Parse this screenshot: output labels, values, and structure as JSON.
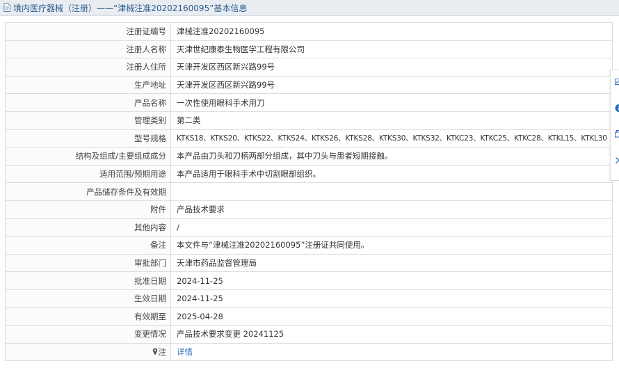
{
  "header": {
    "title": "境内医疗器械（注册）——“津械注准20202160095”基本信息"
  },
  "rows": [
    {
      "label": "注册证编号",
      "value": "津械注准20202160095"
    },
    {
      "label": "注册人名称",
      "value": "天津世纪康泰生物医学工程有限公司"
    },
    {
      "label": "注册人住所",
      "value": "天津开发区西区新兴路99号"
    },
    {
      "label": "生产地址",
      "value": "天津开发区西区新兴路99号"
    },
    {
      "label": "产品名称",
      "value": "一次性使用眼科手术用刀"
    },
    {
      "label": "管理类别",
      "value": "第二类"
    },
    {
      "label": "型号规格",
      "value": "KTKS18、KTKS20、KTKS22、KTKS24、KTKS26、KTKS28、KTKS30、KTKS32、KTKC23、KTKC25、KTKC28、KTKL15、KTKL30"
    },
    {
      "label": "结构及组成/主要组成成分",
      "value": "本产品由刀头和刀柄两部分组成，其中刀头与患者短期接触。"
    },
    {
      "label": "适用范围/预期用途",
      "value": "本产品适用于眼科手术中切割眼部组织。"
    },
    {
      "label": "产品储存条件及有效期",
      "value": ""
    },
    {
      "label": "附件",
      "value": "产品技术要求"
    },
    {
      "label": "其他内容",
      "value": "/"
    },
    {
      "label": "备注",
      "value": "本文件与“津械注准20202160095”注册证共同使用。"
    },
    {
      "label": "审批部门",
      "value": "天津市药品监督管理局"
    },
    {
      "label": "批准日期",
      "value": "2024-11-25"
    },
    {
      "label": "生效日期",
      "value": "2024-11-25"
    },
    {
      "label": "有效期至",
      "value": "2025-04-28"
    },
    {
      "label": "变更情况",
      "value": "产品技术要求变更 20241125"
    },
    {
      "label": "注",
      "value": "详情"
    }
  ],
  "colors": {
    "link": "#2a6eb5",
    "title": "#2a5b8c",
    "header_bg": "#e9edf2"
  },
  "icons": [
    "document-icon",
    "pin-icon",
    "checkbox-icon",
    "info-icon",
    "copy-icon",
    "chevron-right-icon"
  ]
}
